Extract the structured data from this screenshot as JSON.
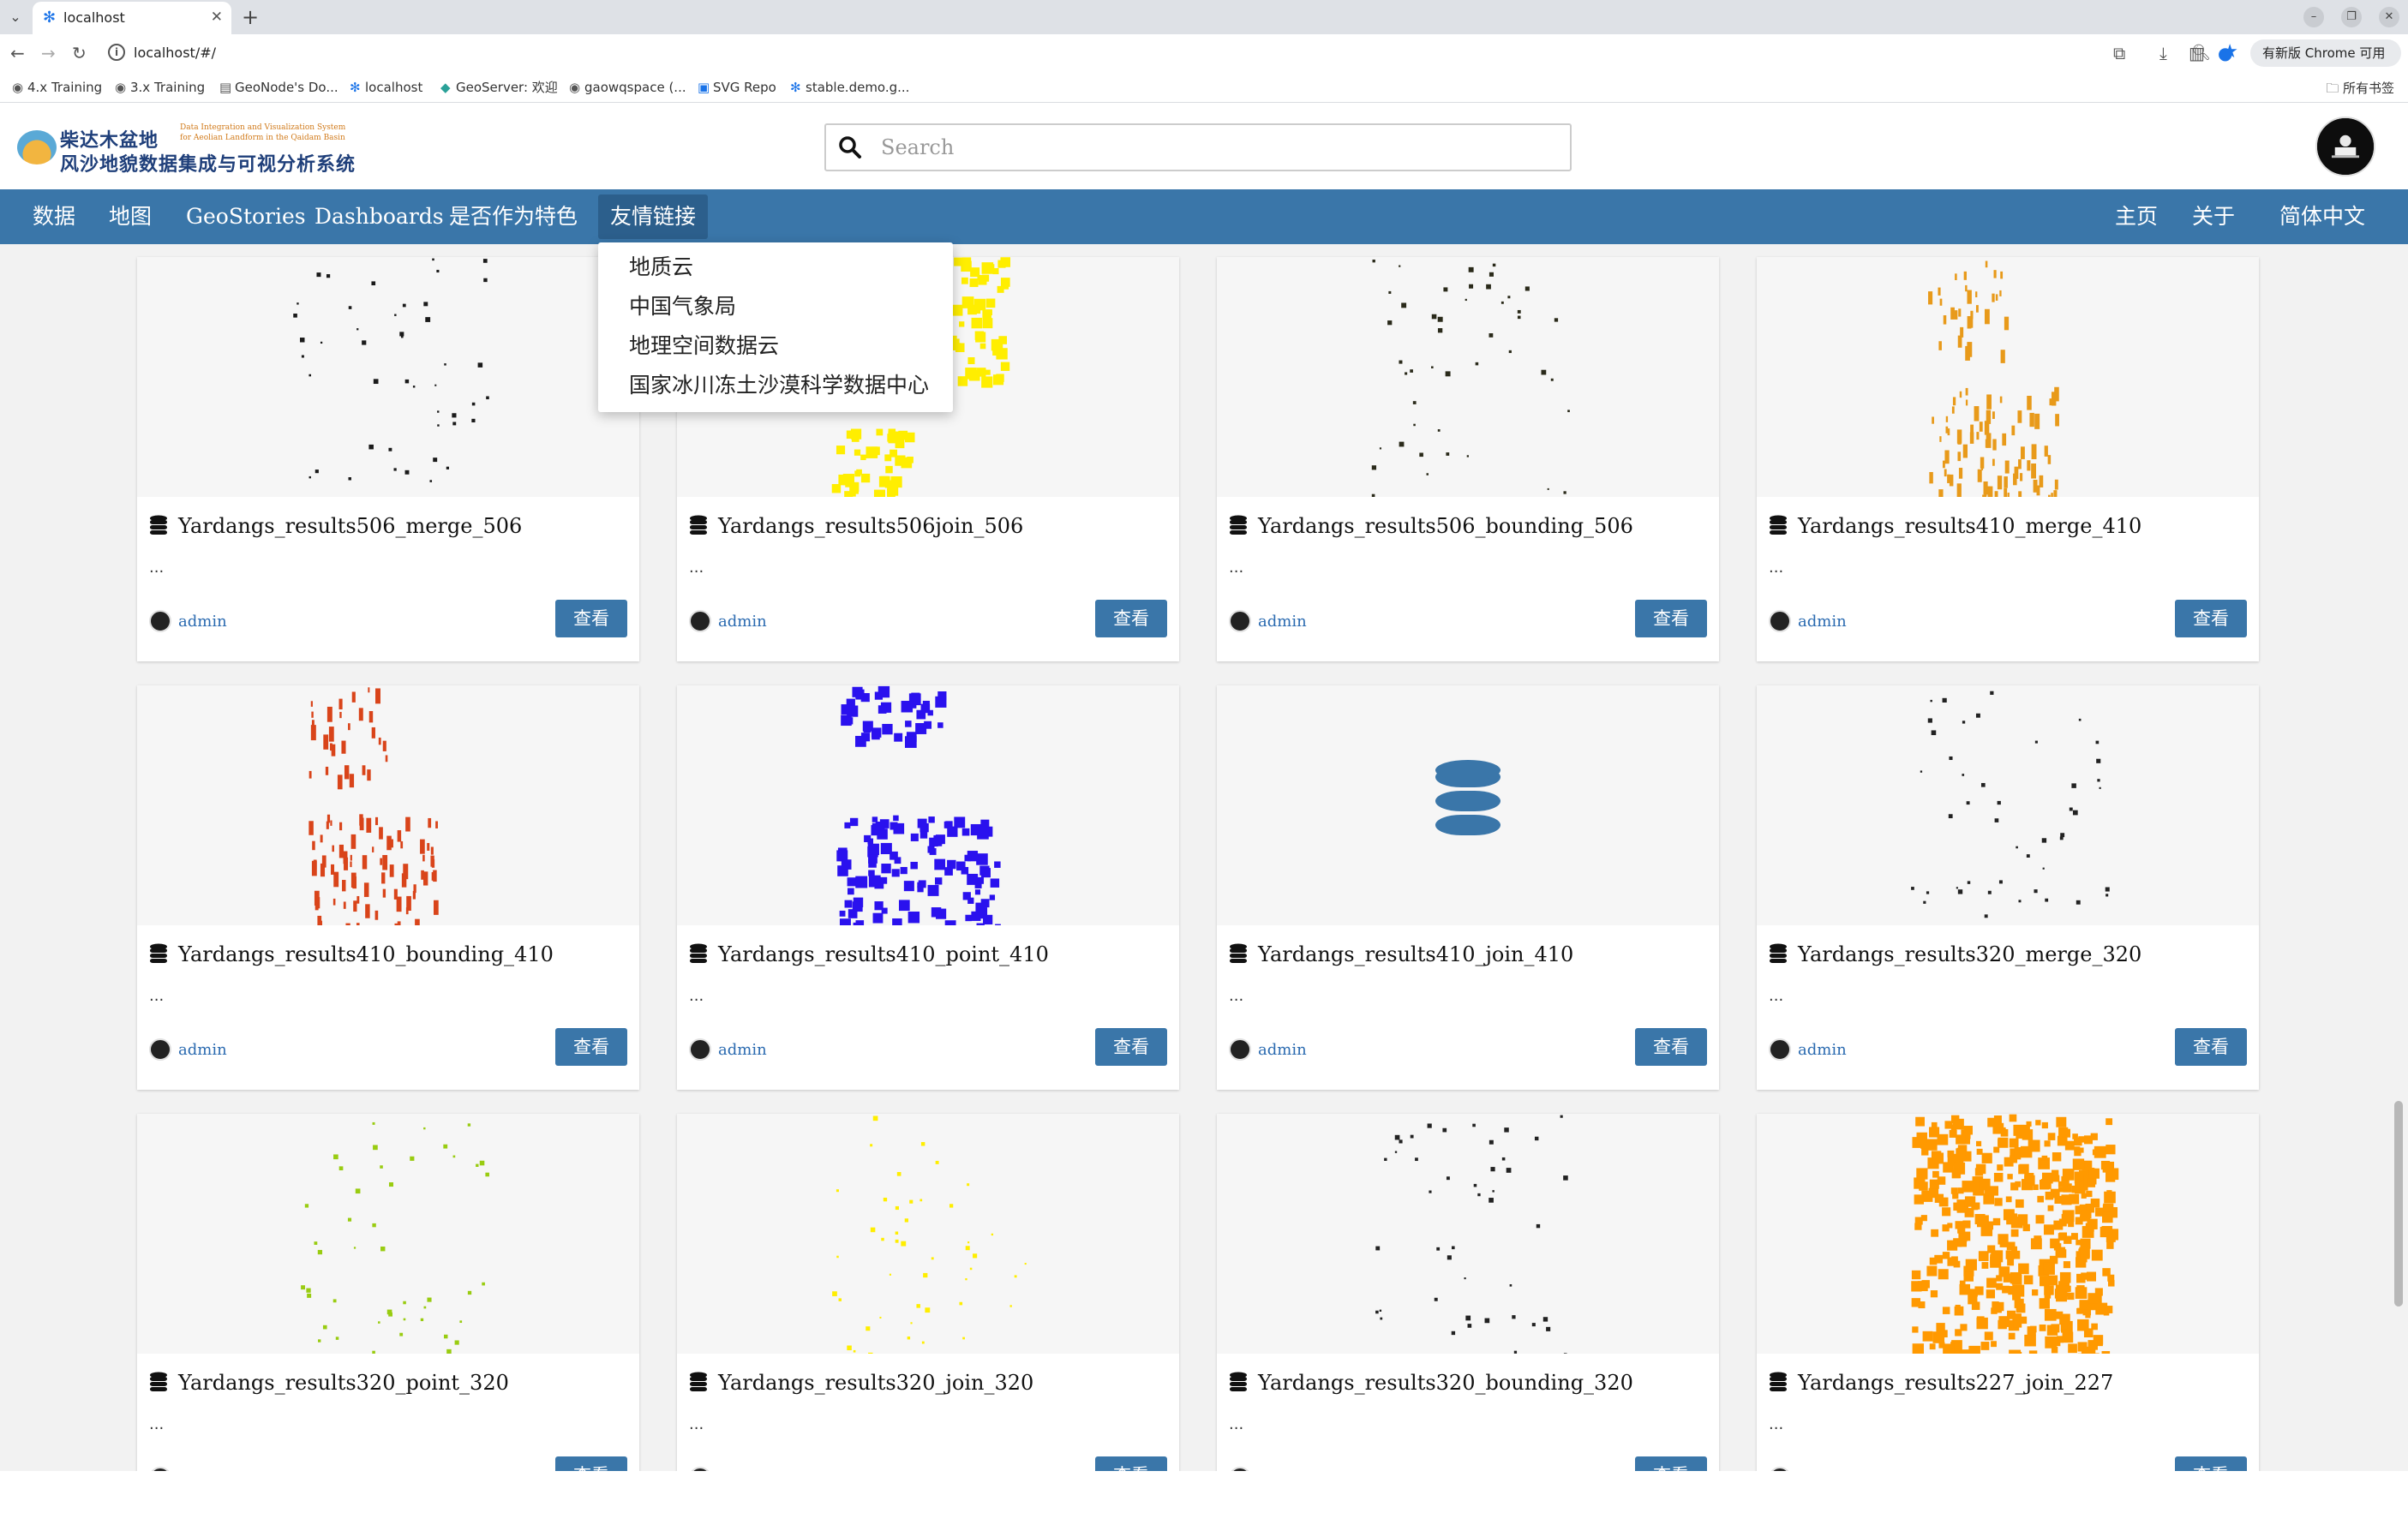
{
  "browser": {
    "tab_title": "localhost",
    "url": "localhost/#/",
    "update_label": "有新版 Chrome 可用",
    "bookmarks": [
      {
        "label": "4.x Training",
        "icon": "github-icon"
      },
      {
        "label": "3.x Training",
        "icon": "github-icon"
      },
      {
        "label": "GeoNode's Do...",
        "icon": "doc-icon"
      },
      {
        "label": "localhost",
        "icon": "snowflake-icon"
      },
      {
        "label": "GeoServer: 欢迎",
        "icon": "geoserver-icon"
      },
      {
        "label": "gaowqspace (...",
        "icon": "github-icon"
      },
      {
        "label": "SVG Repo",
        "icon": "svg-icon"
      },
      {
        "label": "stable.demo.g...",
        "icon": "snowflake-icon"
      }
    ],
    "all_bookmarks": "所有书签"
  },
  "header": {
    "logo_line1": "柴达木盆地",
    "logo_line2": "风沙地貌数据集成与可视分析系统",
    "logo_en1": "Data Integration and Visualization System",
    "logo_en2": "for Aeolian Landform in the Qaidam Basin",
    "search_placeholder": "Search"
  },
  "nav": {
    "items": [
      "数据",
      "地图",
      "GeoStories",
      "Dashboards",
      "是否作为特色",
      "友情链接"
    ],
    "right": [
      "主页",
      "关于",
      "简体中文"
    ]
  },
  "dropdown": {
    "items": [
      "地质云",
      "中国气象局",
      "地理空间数据云",
      "国家冰川冻土沙漠科学数据中心"
    ]
  },
  "cards": [
    {
      "title": "Yardangs_results506_merge_506",
      "dots": "...",
      "user": "admin",
      "button": "查看",
      "thumb_color": "#1a1a1a"
    },
    {
      "title": "Yardangs_results506join_506",
      "dots": "...",
      "user": "admin",
      "button": "查看",
      "thumb_color": "#ffee00"
    },
    {
      "title": "Yardangs_results506_bounding_506",
      "dots": "...",
      "user": "admin",
      "button": "查看",
      "thumb_color": "#2a2a1a"
    },
    {
      "title": "Yardangs_results410_merge_410",
      "dots": "...",
      "user": "admin",
      "button": "查看",
      "thumb_color": "#e89a1a"
    },
    {
      "title": "Yardangs_results410_bounding_410",
      "dots": "...",
      "user": "admin",
      "button": "查看",
      "thumb_color": "#d9441a"
    },
    {
      "title": "Yardangs_results410_point_410",
      "dots": "...",
      "user": "admin",
      "button": "查看",
      "thumb_color": "#2a11ee"
    },
    {
      "title": "Yardangs_results410_join_410",
      "dots": "...",
      "user": "admin",
      "button": "查看",
      "thumb_color": "#3a76a9"
    },
    {
      "title": "Yardangs_results320_merge_320",
      "dots": "...",
      "user": "admin",
      "button": "查看",
      "thumb_color": "#222222"
    },
    {
      "title": "Yardangs_results320_point_320",
      "dots": "...",
      "user": "",
      "button": "查看",
      "thumb_color": "#99cc11"
    },
    {
      "title": "Yardangs_results320_join_320",
      "dots": "...",
      "user": "",
      "button": "查看",
      "thumb_color": "#ffee00"
    },
    {
      "title": "Yardangs_results320_bounding_320",
      "dots": "...",
      "user": "",
      "button": "查看",
      "thumb_color": "#222222"
    },
    {
      "title": "Yardangs_results227_join_227",
      "dots": "...",
      "user": "",
      "button": "查看",
      "thumb_color": "#ff9900"
    }
  ]
}
